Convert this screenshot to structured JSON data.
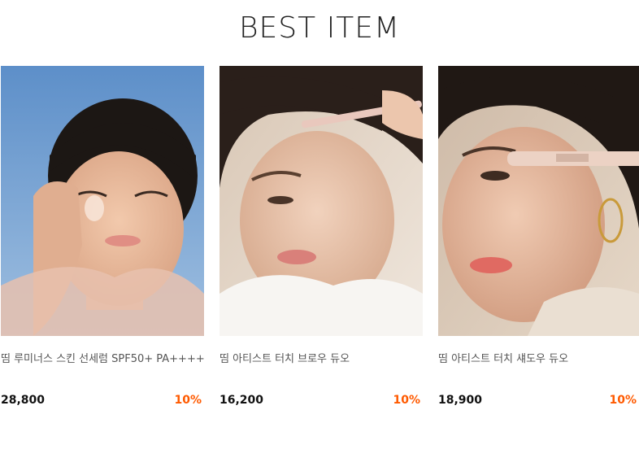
{
  "section": {
    "title": "BEST ITEM"
  },
  "products": [
    {
      "name": "띰 루미너스 스킨 선세럼 SPF50+ PA++++",
      "price": "28,800",
      "discount": "10%",
      "image": "model-applying-sun-serum-photo"
    },
    {
      "name": "띰 아티스트 터치 브로우 듀오",
      "price": "16,200",
      "discount": "10%",
      "image": "model-applying-brow-pencil-photo"
    },
    {
      "name": "띰 아티스트 터치 섀도우 듀오",
      "price": "18,900",
      "discount": "10%",
      "image": "model-applying-shadow-stick-photo"
    }
  ],
  "colors": {
    "discount": "#ff5a00",
    "price": "#111111",
    "name": "#555555"
  }
}
